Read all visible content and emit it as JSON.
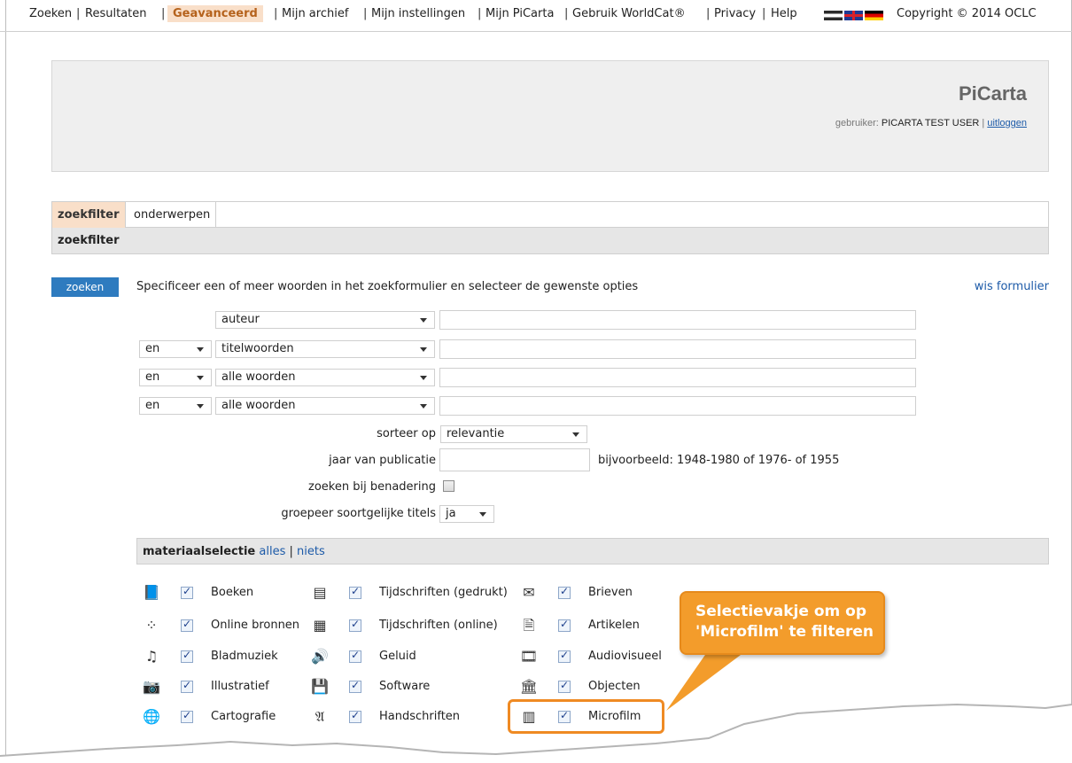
{
  "topnav": {
    "items": [
      "Zoeken",
      "Resultaten",
      "Geavanceerd",
      "Mijn archief",
      "Mijn instellingen",
      "Mijn PiCarta",
      "Gebruik WorldCat®",
      "Privacy",
      "Help"
    ],
    "copyright": "Copyright © 2014 OCLC"
  },
  "banner": {
    "brand": "PiCarta",
    "user_prefix": "gebruiker:",
    "user_name": "PICARTA TEST USER",
    "logout": "uitloggen"
  },
  "tabs": [
    "zoekfilter",
    "onderwerpen"
  ],
  "section_title": "zoekfilter",
  "search": {
    "button": "zoeken",
    "instructions": "Specificeer een of meer woorden in het zoekformulier en selecteer de gewenste opties",
    "clear": "wis formulier",
    "rows": [
      {
        "operator": "",
        "field": "auteur"
      },
      {
        "operator": "en",
        "field": "titelwoorden"
      },
      {
        "operator": "en",
        "field": "alle woorden"
      },
      {
        "operator": "en",
        "field": "alle woorden"
      }
    ],
    "sort_label": "sorteer op",
    "sort_value": "relevantie",
    "year_label": "jaar van publicatie",
    "year_example": "bijvoorbeeld: 1948-1980 of 1976- of 1955",
    "approx_label": "zoeken bij benadering",
    "group_label": "groepeer soortgelijke titels",
    "group_value": "ja"
  },
  "materials": {
    "title": "materiaalselectie",
    "all": "alles",
    "none": "niets",
    "items": [
      {
        "name": "Boeken",
        "icon": "book-icon",
        "checked": true
      },
      {
        "name": "Online bronnen",
        "icon": "online-icon",
        "checked": true
      },
      {
        "name": "Bladmuziek",
        "icon": "sheet-music-icon",
        "checked": true
      },
      {
        "name": "Illustratief",
        "icon": "camera-icon",
        "checked": true
      },
      {
        "name": "Cartografie",
        "icon": "globe-icon",
        "checked": true
      },
      {
        "name": "Tijdschriften (gedrukt)",
        "icon": "journal-icon",
        "checked": true
      },
      {
        "name": "Tijdschriften (online)",
        "icon": "journal-online-icon",
        "checked": true
      },
      {
        "name": "Geluid",
        "icon": "speaker-icon",
        "checked": true
      },
      {
        "name": "Software",
        "icon": "floppy-icon",
        "checked": true
      },
      {
        "name": "Handschriften",
        "icon": "manuscript-icon",
        "checked": true
      },
      {
        "name": "Brieven",
        "icon": "envelope-icon",
        "checked": true
      },
      {
        "name": "Artikelen",
        "icon": "article-icon",
        "checked": true
      },
      {
        "name": "Audiovisueel",
        "icon": "film-icon",
        "checked": true
      },
      {
        "name": "Objecten",
        "icon": "object-icon",
        "checked": true
      },
      {
        "name": "Microfilm",
        "icon": "microfilm-icon",
        "checked": true
      }
    ]
  },
  "callout": {
    "line1": "Selectievakje om op",
    "line2": "'Microfilm' te filteren"
  },
  "colors": {
    "accent": "#f9dfc9",
    "link": "#1c5aa8",
    "button": "#2e7bbf",
    "callout": "#f39c2b"
  }
}
